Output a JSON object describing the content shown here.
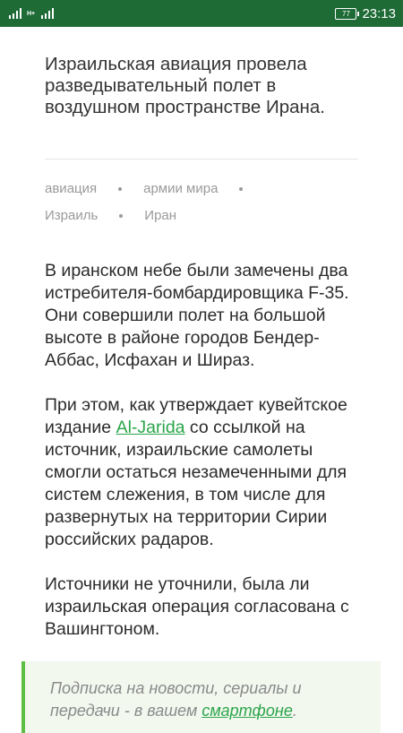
{
  "status_bar": {
    "network_label": "H+",
    "battery": "77",
    "time": "23:13"
  },
  "article": {
    "title": "Израильская авиация провела разведывательный полет в воздушном пространстве Ирана.",
    "tags": [
      "авиация",
      "армии мира",
      "Израиль",
      "Иран"
    ],
    "paragraph1": "В иранском небе были замечены два истребителя-бомбардировщика F-35. Они совершили полет на большой высоте в районе городов Бендер-Аббас, Исфахан и Шираз.",
    "paragraph2_before": "При этом, как утверждает кувейтское издание ",
    "paragraph2_link": "Al-Jarida",
    "paragraph2_after": " со ссылкой на источник, израильские самолеты смогли остаться незамеченными для систем слежения, в том числе для развернутых на территории Сирии российских радаров.",
    "paragraph3": "Источники не уточнили, была ли израильская операция согласована с Вашингтоном."
  },
  "promo": {
    "text": "Подписка на новости, сериалы и передачи - в вашем ",
    "link": "смартфоне",
    "end": "."
  },
  "colors": {
    "status_bar": "#1e6b36",
    "accent": "#2aa54a",
    "promo_border": "#5cbf44",
    "promo_bg": "#f3f8ef"
  }
}
